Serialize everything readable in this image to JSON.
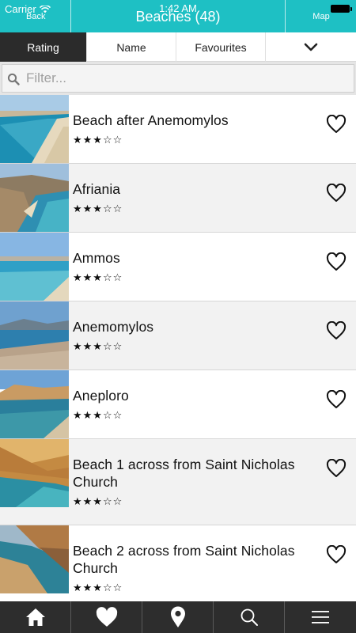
{
  "status": {
    "carrier": "Carrier",
    "time": "1:42 AM"
  },
  "nav": {
    "back_label": "Back",
    "title": "Beaches (48)",
    "map_label": "Map"
  },
  "tabs": [
    {
      "label": "Rating",
      "active": true
    },
    {
      "label": "Name",
      "active": false
    },
    {
      "label": "Favourites",
      "active": false
    },
    {
      "label": "",
      "icon": "chevron-down-icon"
    }
  ],
  "filter": {
    "placeholder": "Filter...",
    "value": ""
  },
  "beaches": [
    {
      "name": "Beach after Anemomylos",
      "stars": "★★★☆☆",
      "rating": 3,
      "favourite": false
    },
    {
      "name": "Afriania",
      "stars": "★★★☆☆",
      "rating": 3,
      "favourite": false
    },
    {
      "name": "Ammos",
      "stars": "★★★☆☆",
      "rating": 3,
      "favourite": false
    },
    {
      "name": "Anemomylos",
      "stars": "★★★☆☆",
      "rating": 3,
      "favourite": false
    },
    {
      "name": "Aneploro",
      "stars": "★★★☆☆",
      "rating": 3,
      "favourite": false
    },
    {
      "name": "Beach 1 across from Saint Nicholas Church",
      "stars": "★★★☆☆",
      "rating": 3,
      "favourite": false
    },
    {
      "name": "Beach 2 across from Saint Nicholas Church",
      "stars": "★★★☆☆",
      "rating": 3,
      "favourite": false
    }
  ],
  "bottom_nav": [
    {
      "icon": "home-icon"
    },
    {
      "icon": "heart-icon"
    },
    {
      "icon": "map-pin-icon"
    },
    {
      "icon": "search-icon"
    },
    {
      "icon": "menu-icon"
    }
  ],
  "colors": {
    "accent": "#1ec0c4",
    "tab_active": "#2b2b2b",
    "bottom_bar": "#2d2d2d"
  }
}
